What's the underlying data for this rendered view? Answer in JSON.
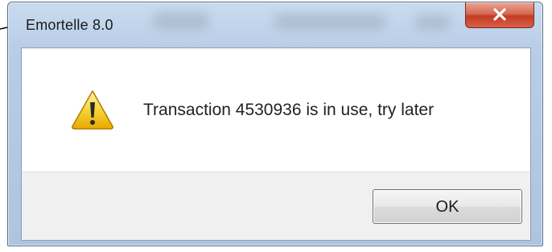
{
  "dialog": {
    "title": "Emortelle 8.0",
    "message": "Transaction 4530936 is in use, try later",
    "ok_label": "OK",
    "close_symbol": "x"
  },
  "icons": {
    "warning": "warning-icon",
    "close": "close-icon",
    "pointer": "pointer-arrow-icon"
  },
  "colors": {
    "close_button": "#c43b22",
    "warning_fill": "#f2c200",
    "frame": "#aec4df"
  }
}
